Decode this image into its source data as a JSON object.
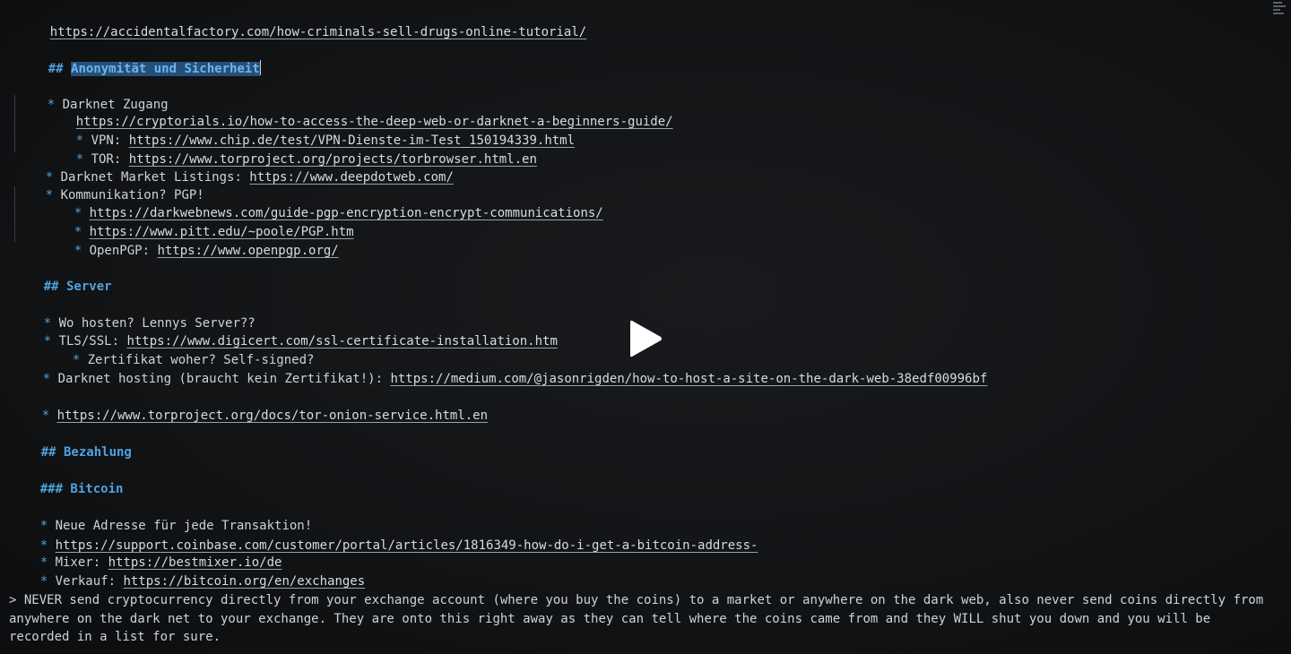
{
  "lines": {
    "l1_url": "https://accidentalfactory.com/how-criminals-sell-drugs-online-tutorial/",
    "l2_hash": "## ",
    "l2_heading": "Anonymität und Sicherheit",
    "l3_bullet": "* ",
    "l3_text": "Darknet Zugang",
    "l4_url": "https://cryptorials.io/how-to-access-the-deep-web-or-darknet-a-beginners-guide/",
    "l5_bullet": "* ",
    "l5_text": "VPN: ",
    "l5_url": "https://www.chip.de/test/VPN-Dienste-im-Test_150194339.html",
    "l6_bullet": "* ",
    "l6_text": "TOR: ",
    "l6_url": "https://www.torproject.org/projects/torbrowser.html.en",
    "l7_bullet": "* ",
    "l7_text": "Darknet Market Listings: ",
    "l7_url": "https://www.deepdotweb.com/",
    "l8_bullet": "* ",
    "l8_text": "Kommunikation? PGP!",
    "l9_bullet": "* ",
    "l9_url": "https://darkwebnews.com/guide-pgp-encryption-encrypt-communications/",
    "l10_bullet": "* ",
    "l10_url": "https://www.pitt.edu/~poole/PGP.htm",
    "l11_bullet": "* ",
    "l11_text": "OpenPGP: ",
    "l11_url": "https://www.openpgp.org/",
    "l12_heading": "## Server",
    "l13_bullet": "* ",
    "l13_text": "Wo hosten? Lennys Server??",
    "l14_bullet": "* ",
    "l14_text": "TLS/SSL: ",
    "l14_url": "https://www.digicert.com/ssl-certificate-installation.htm",
    "l15_bullet": "* ",
    "l15_text": "Zertifikat woher? Self-signed?",
    "l16_bullet": "* ",
    "l16_text": "Darknet hosting (braucht kein Zertifikat!): ",
    "l16_url": "https://medium.com/@jasonrigden/how-to-host-a-site-on-the-dark-web-38edf00996bf",
    "l17_bullet": "* ",
    "l17_url": "https://www.torproject.org/docs/tor-onion-service.html.en",
    "l18_heading": "## Bezahlung",
    "l19_heading": "### Bitcoin",
    "l20_bullet": "* ",
    "l20_text": "Neue Adresse für jede Transaktion!",
    "l21_bullet": "* ",
    "l21_url": "https://support.coinbase.com/customer/portal/articles/1816349-how-do-i-get-a-bitcoin-address-",
    "l22_bullet": "* ",
    "l22_text": "Mixer: ",
    "l22_url": "https://bestmixer.io/de",
    "l23_bullet": "* ",
    "l23_text": "Verkauf: ",
    "l23_url": "https://bitcoin.org/en/exchanges",
    "quote_mark": "> ",
    "quote_text": "NEVER send cryptocurrency directly from your exchange account (where you buy the coins) to a market or anywhere on the dark web, also never send coins directly from anywhere on the dark net to your exchange. They are onto this right away as they can tell where the coins came from and they WILL shut you down and you will be recorded in a list for sure."
  },
  "icons": {
    "play": "play-icon"
  },
  "colors": {
    "heading": "#4fa3df",
    "selection": "#264f78",
    "background": "#121416"
  }
}
